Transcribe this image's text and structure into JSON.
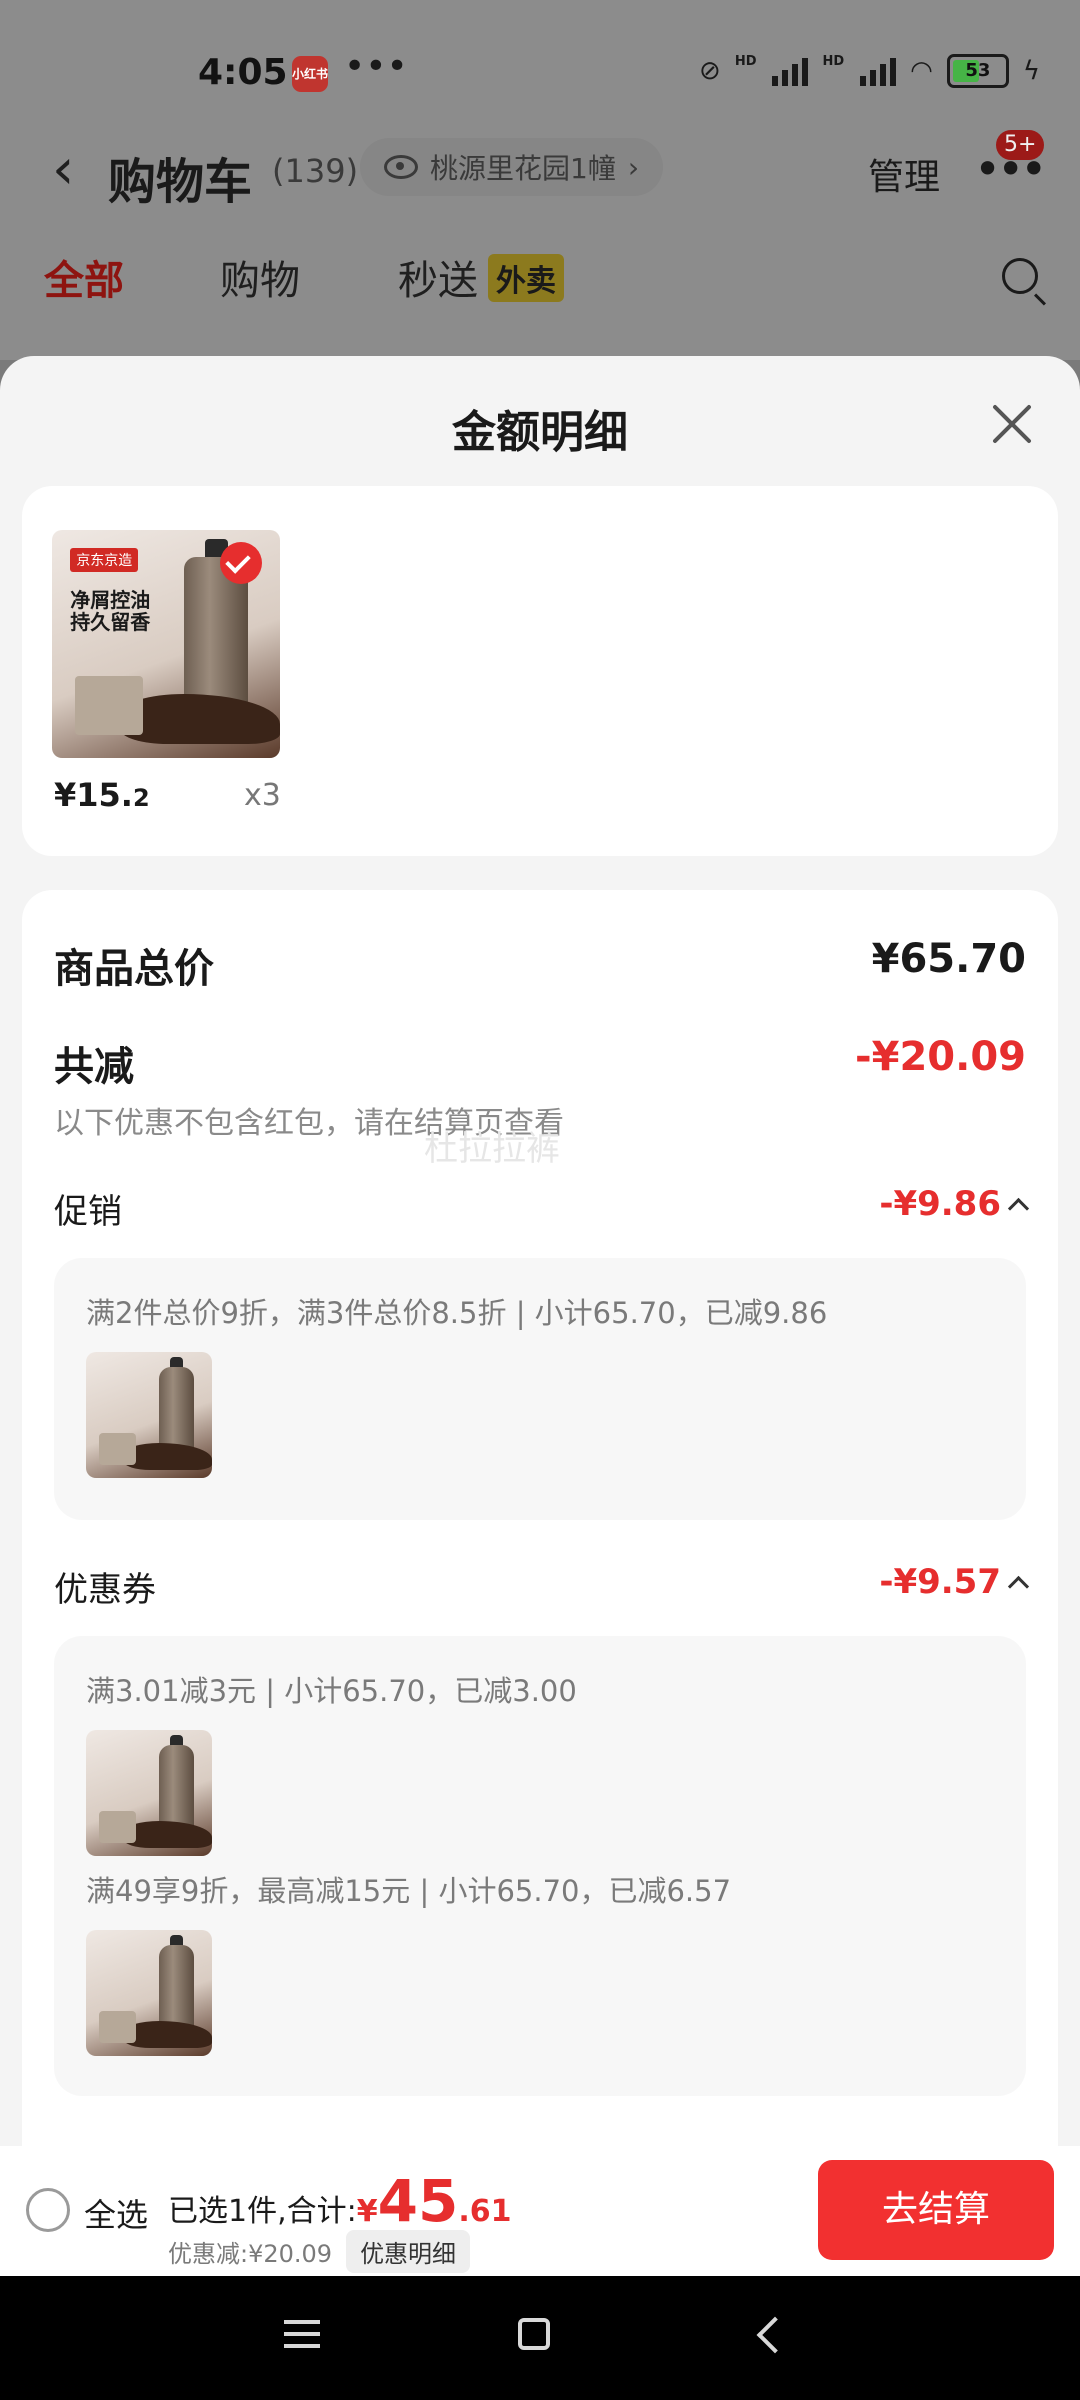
{
  "status_bar": {
    "time": "4:05",
    "app_badge": "小红书",
    "dots": "•••",
    "battery": "53"
  },
  "header": {
    "title": "购物车",
    "count": "(139)",
    "address": "桃源里花园1幢",
    "manage": "管理",
    "badge": "5+"
  },
  "tabs": {
    "all": "全部",
    "shopping": "购物",
    "flash": "秒送",
    "takeout": "外卖"
  },
  "sheet": {
    "title": "金额明细",
    "product": {
      "brand": "京东京造",
      "slogan": "净屑控油 持久留香",
      "price_main": "¥15.",
      "price_dec": "2",
      "qty": "x3"
    },
    "total_label": "商品总价",
    "total_value": "¥65.70",
    "reduce_label": "共减",
    "reduce_value": "-¥20.09",
    "reduce_note": "以下优惠不包含红包，请在结算页查看",
    "watermark": "杜拉拉裤",
    "promo": {
      "label": "促销",
      "value": "-¥9.86",
      "line1": "满2件总价9折，满3件总价8.5折 | 小计65.70，已减9.86"
    },
    "coupon": {
      "label": "优惠券",
      "value": "-¥9.57",
      "line1": "满3.01减3元 | 小计65.70，已减3.00",
      "line2": "满49享9折，最高减15元 | 小计65.70，已减6.57"
    }
  },
  "checkout": {
    "select_all": "全选",
    "selected_text": "已选1件,合计:",
    "currency": "¥",
    "total_int": "45",
    "total_dec": ".61",
    "discount_text": "优惠减:¥20.09",
    "detail_chip": "优惠明细",
    "pay_button": "去结算"
  },
  "colors": {
    "accent": "#e62e2e",
    "pay": "#f23030"
  }
}
